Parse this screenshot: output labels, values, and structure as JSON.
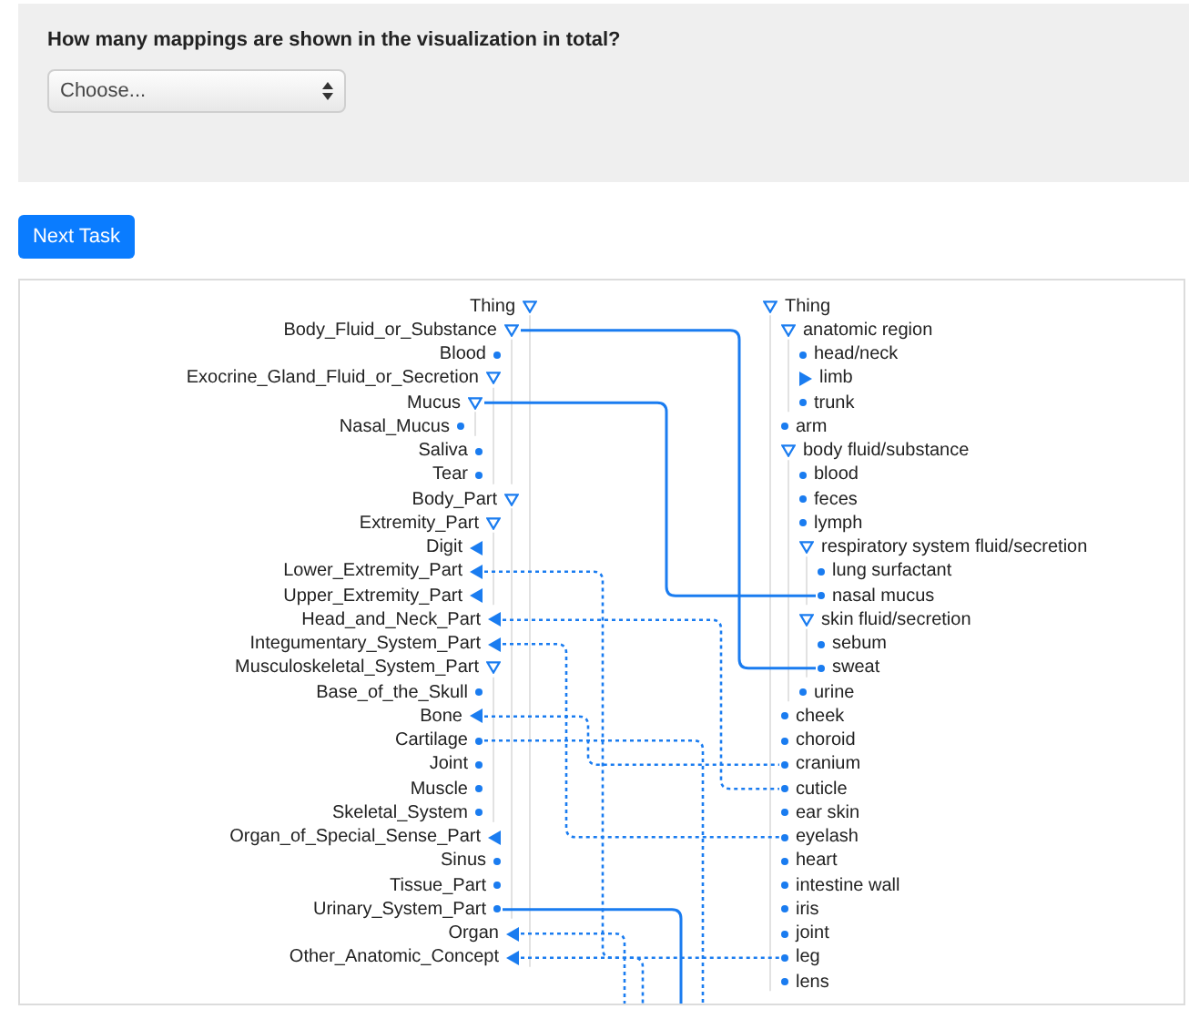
{
  "question": {
    "text": "How many mappings are shown in the visualization in total?",
    "select": {
      "placeholder": "Choose..."
    }
  },
  "next_button": "Next Task",
  "left_tree": [
    {
      "label": "Thing",
      "kind": "expanded",
      "children": [
        {
          "label": "Body_Fluid_or_Substance",
          "kind": "expanded",
          "dashed": false,
          "children": [
            {
              "label": "Blood",
              "kind": "leaf"
            },
            {
              "label": "Exocrine_Gland_Fluid_or_Secretion",
              "kind": "expanded",
              "children": [
                {
                  "label": "Mucus",
                  "kind": "expanded",
                  "dashed": false,
                  "children": [
                    {
                      "label": "Nasal_Mucus",
                      "kind": "leaf"
                    }
                  ]
                },
                {
                  "label": "Saliva",
                  "kind": "leaf"
                },
                {
                  "label": "Tear",
                  "kind": "leaf"
                }
              ]
            }
          ]
        },
        {
          "label": "Body_Part",
          "kind": "expanded",
          "children": [
            {
              "label": "Extremity_Part",
              "kind": "expanded",
              "children": [
                {
                  "label": "Digit",
                  "kind": "collapsed"
                },
                {
                  "label": "Lower_Extremity_Part",
                  "kind": "collapsed",
                  "dashed": true
                },
                {
                  "label": "Upper_Extremity_Part",
                  "kind": "collapsed"
                }
              ]
            },
            {
              "label": "Head_and_Neck_Part",
              "kind": "collapsed",
              "dashed": true
            },
            {
              "label": "Integumentary_System_Part",
              "kind": "collapsed",
              "dashed": true
            },
            {
              "label": "Musculoskeletal_System_Part",
              "kind": "expanded",
              "children": [
                {
                  "label": "Base_of_the_Skull",
                  "kind": "leaf"
                },
                {
                  "label": "Bone",
                  "kind": "collapsed",
                  "dashed": true
                },
                {
                  "label": "Cartilage",
                  "kind": "leaf",
                  "dashed": true
                },
                {
                  "label": "Joint",
                  "kind": "leaf"
                },
                {
                  "label": "Muscle",
                  "kind": "leaf"
                },
                {
                  "label": "Skeletal_System",
                  "kind": "leaf"
                }
              ]
            },
            {
              "label": "Organ_of_Special_Sense_Part",
              "kind": "collapsed"
            },
            {
              "label": "Sinus",
              "kind": "leaf"
            },
            {
              "label": "Tissue_Part",
              "kind": "leaf"
            },
            {
              "label": "Urinary_System_Part",
              "kind": "leaf",
              "dashed": false
            }
          ]
        },
        {
          "label": "Organ",
          "kind": "collapsed",
          "dashed": true
        },
        {
          "label": "Other_Anatomic_Concept",
          "kind": "collapsed",
          "dashed": true
        }
      ]
    }
  ],
  "right_tree": [
    {
      "label": "Thing",
      "kind": "expanded",
      "children": [
        {
          "label": "anatomic region",
          "kind": "expanded",
          "children": [
            {
              "label": "head/neck",
              "kind": "leaf"
            },
            {
              "label": "limb",
              "kind": "collapsed"
            },
            {
              "label": "trunk",
              "kind": "leaf"
            }
          ]
        },
        {
          "label": "arm",
          "kind": "leaf"
        },
        {
          "label": "body fluid/substance",
          "kind": "expanded",
          "children": [
            {
              "label": "blood",
              "kind": "leaf"
            },
            {
              "label": "feces",
              "kind": "leaf"
            },
            {
              "label": "lymph",
              "kind": "leaf"
            },
            {
              "label": "respiratory system fluid/secretion",
              "kind": "expanded",
              "children": [
                {
                  "label": "lung surfactant",
                  "kind": "leaf"
                },
                {
                  "label": "nasal mucus",
                  "kind": "leaf"
                }
              ]
            },
            {
              "label": "skin fluid/secretion",
              "kind": "expanded",
              "children": [
                {
                  "label": "sebum",
                  "kind": "leaf"
                },
                {
                  "label": "sweat",
                  "kind": "leaf"
                }
              ]
            },
            {
              "label": "urine",
              "kind": "leaf"
            }
          ]
        },
        {
          "label": "cheek",
          "kind": "leaf"
        },
        {
          "label": "choroid",
          "kind": "leaf"
        },
        {
          "label": "cranium",
          "kind": "leaf"
        },
        {
          "label": "cuticle",
          "kind": "leaf"
        },
        {
          "label": "ear skin",
          "kind": "leaf"
        },
        {
          "label": "eyelash",
          "kind": "leaf"
        },
        {
          "label": "heart",
          "kind": "leaf"
        },
        {
          "label": "intestine wall",
          "kind": "leaf"
        },
        {
          "label": "iris",
          "kind": "leaf"
        },
        {
          "label": "joint",
          "kind": "leaf"
        },
        {
          "label": "leg",
          "kind": "leaf"
        },
        {
          "label": "lens",
          "kind": "leaf"
        }
      ]
    }
  ]
}
